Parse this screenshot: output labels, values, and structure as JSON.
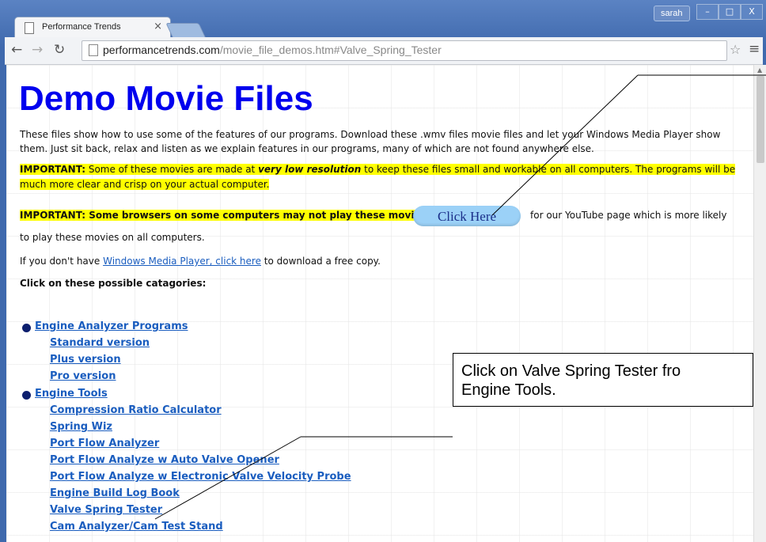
{
  "browser": {
    "tab_title": "Performance Trends",
    "user": "sarah",
    "url_host": "performancetrends.com",
    "url_path": "/movie_file_demos.htm#Valve_Spring_Tester"
  },
  "page": {
    "title": "Demo Movie Files",
    "intro_line1": "These files show how to use some of the features of our programs.  Download these .wmv files movie files and let your Windows Media Player show",
    "intro_line2": "them.  Just sit back, relax and listen as we explain features in our programs, many of which are not found anywhere else.",
    "important1_label": "IMPORTANT:",
    "important1_text_a": "  Some of these movies are made at ",
    "important1_emph": "very low resolution",
    "important1_text_b": " to keep these files small and workable on all computers.  The programs will be",
    "important1_line2": "much more clear and crisp on your actual computer.",
    "important2": "IMPORTANT:  Some browsers on some computers may not play these movies.",
    "click_here": "Click Here",
    "youtube_text": "for our YouTube page which is more likely",
    "youtube_line2": "to play these movies on all computers.",
    "wmp_prefix": "If you don't have ",
    "wmp_link": "Windows Media Player, click here",
    "wmp_suffix": " to download a free copy.",
    "categories_heading": "Click on these possible catagories:",
    "categories": [
      {
        "label": "Engine Analyzer Programs ",
        "sub": [
          "Standard version",
          "Plus version",
          "Pro version"
        ]
      },
      {
        "label": "Engine Tools",
        "sub": [
          "Compression Ratio Calculator",
          "Spring Wiz",
          "Port Flow Analyzer",
          "Port Flow Analyze w Auto Valve Opener",
          "Port Flow Analyze w Electronic Valve Velocity Probe",
          "Engine Build Log Book",
          "Valve Spring Tester",
          "Cam Analyzer/Cam Test Stand"
        ]
      }
    ]
  },
  "callout": {
    "line1": "Click on Valve Spring Tester fro",
    "line2": "Engine Tools."
  }
}
